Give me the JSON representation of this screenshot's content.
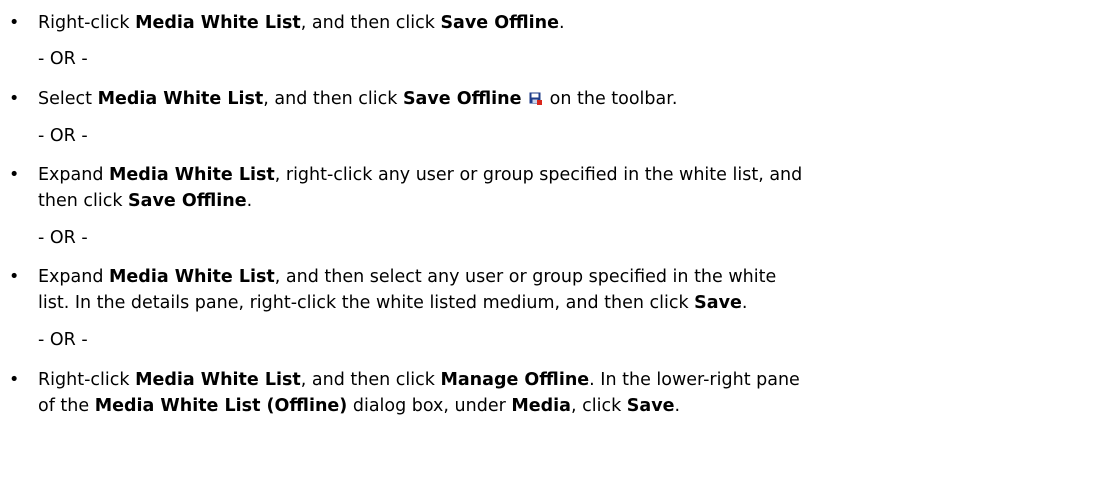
{
  "items": [
    {
      "lines": [
        [
          "Right-click ",
          {
            "b": "Media White List"
          },
          ", and then click ",
          {
            "b": "Save Offline"
          },
          "."
        ]
      ]
    },
    {
      "lines": [
        [
          "Select ",
          {
            "b": "Media White List"
          },
          ", and then click ",
          {
            "b": "Save Offline"
          },
          " ",
          {
            "icon": "save-icon"
          },
          " on the toolbar."
        ]
      ]
    },
    {
      "lines": [
        [
          "Expand ",
          {
            "b": "Media White List"
          },
          ", right-click any user or group specified in the white list, and"
        ],
        [
          "then click ",
          {
            "b": "Save Offline"
          },
          "."
        ]
      ]
    },
    {
      "lines": [
        [
          "Expand ",
          {
            "b": "Media White List"
          },
          ", and then select any user or group specified in the white"
        ],
        [
          "list. In the details pane, right-click the white listed medium, and then click ",
          {
            "b": "Save"
          },
          "."
        ]
      ]
    },
    {
      "lines": [
        [
          "Right-click ",
          {
            "b": "Media White List"
          },
          ", and then click ",
          {
            "b": "Manage Offline"
          },
          ". In the lower-right pane"
        ],
        [
          "of the ",
          {
            "b": "Media White List (Offline)"
          },
          " dialog box, under ",
          {
            "b": "Media"
          },
          ", click ",
          {
            "b": "Save"
          },
          "."
        ]
      ]
    }
  ],
  "bullet_glyph": "•",
  "or_text": "- OR -",
  "icon_colors": {
    "body": "#1f3d8a",
    "label": "#ffffff",
    "accent": "#d9261c"
  }
}
